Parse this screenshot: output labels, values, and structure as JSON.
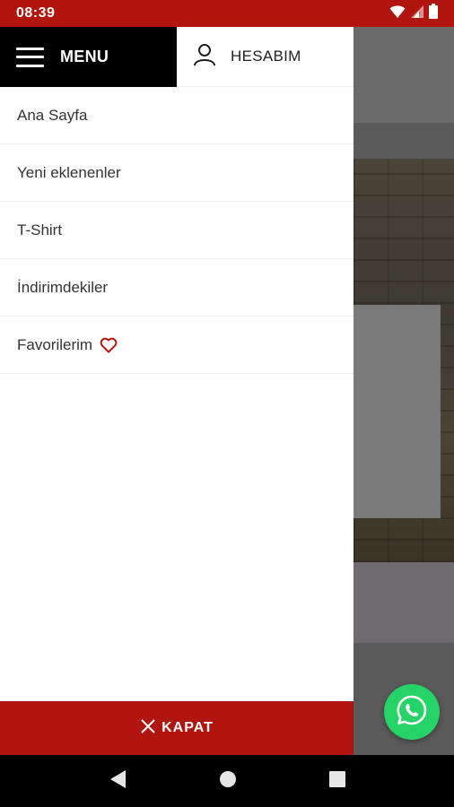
{
  "status_bar": {
    "time": "08:39",
    "icons": [
      "wifi-icon",
      "signal-icon",
      "battery-icon"
    ]
  },
  "drawer": {
    "menu_label": "MENU",
    "account_label": "HESABIM",
    "items": [
      {
        "label": "Ana Sayfa"
      },
      {
        "label": "Yeni eklenenler"
      },
      {
        "label": "T-Shirt"
      },
      {
        "label": "İndirimdekiler"
      },
      {
        "label": "Favorilerim",
        "icon": "heart-icon"
      }
    ],
    "close_label": "KAPAT"
  },
  "fab": {
    "icon": "whatsapp-icon"
  },
  "system_nav": [
    "back-icon",
    "home-icon",
    "recents-icon"
  ],
  "colors": {
    "accent": "#b0150f",
    "menu_bg": "#000000",
    "whatsapp": "#25d366"
  }
}
